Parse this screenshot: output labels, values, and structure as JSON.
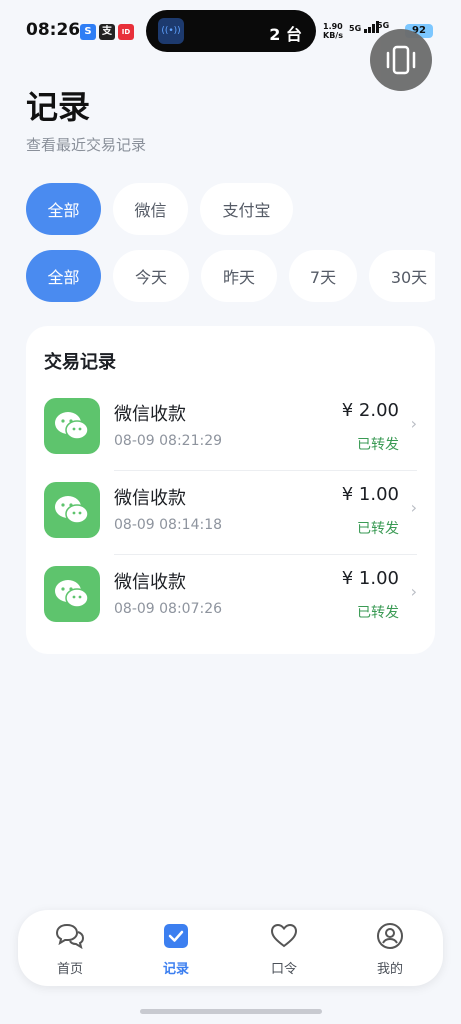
{
  "status_bar": {
    "time": "08:26",
    "island_text": "2 台",
    "net_speed": "1.90",
    "net_unit": "KB/s",
    "sig1": "5G",
    "sig2": "5G",
    "battery": "92"
  },
  "header": {
    "title": "记录",
    "subtitle": "查看最近交易记录"
  },
  "source_filters": [
    {
      "label": "全部",
      "active": true
    },
    {
      "label": "微信",
      "active": false
    },
    {
      "label": "支付宝",
      "active": false
    }
  ],
  "time_filters": [
    {
      "label": "全部",
      "active": true
    },
    {
      "label": "今天",
      "active": false
    },
    {
      "label": "昨天",
      "active": false
    },
    {
      "label": "7天",
      "active": false
    },
    {
      "label": "30天",
      "active": false
    }
  ],
  "records": {
    "title": "交易记录",
    "items": [
      {
        "name": "微信收款",
        "time": "08-09 08:21:29",
        "amount": "¥ 2.00",
        "status": "已转发"
      },
      {
        "name": "微信收款",
        "time": "08-09 08:14:18",
        "amount": "¥ 1.00",
        "status": "已转发"
      },
      {
        "name": "微信收款",
        "time": "08-09 08:07:26",
        "amount": "¥ 1.00",
        "status": "已转发"
      }
    ]
  },
  "nav": {
    "items": [
      {
        "label": "首页",
        "icon": "chat-bubbles-icon"
      },
      {
        "label": "记录",
        "icon": "checkbox-icon",
        "active": true
      },
      {
        "label": "口令",
        "icon": "heart-icon"
      },
      {
        "label": "我的",
        "icon": "user-icon"
      }
    ]
  },
  "colors": {
    "accent": "#4a8bf0",
    "wechat": "#5ec46d",
    "forwarded": "#3a9a54"
  }
}
